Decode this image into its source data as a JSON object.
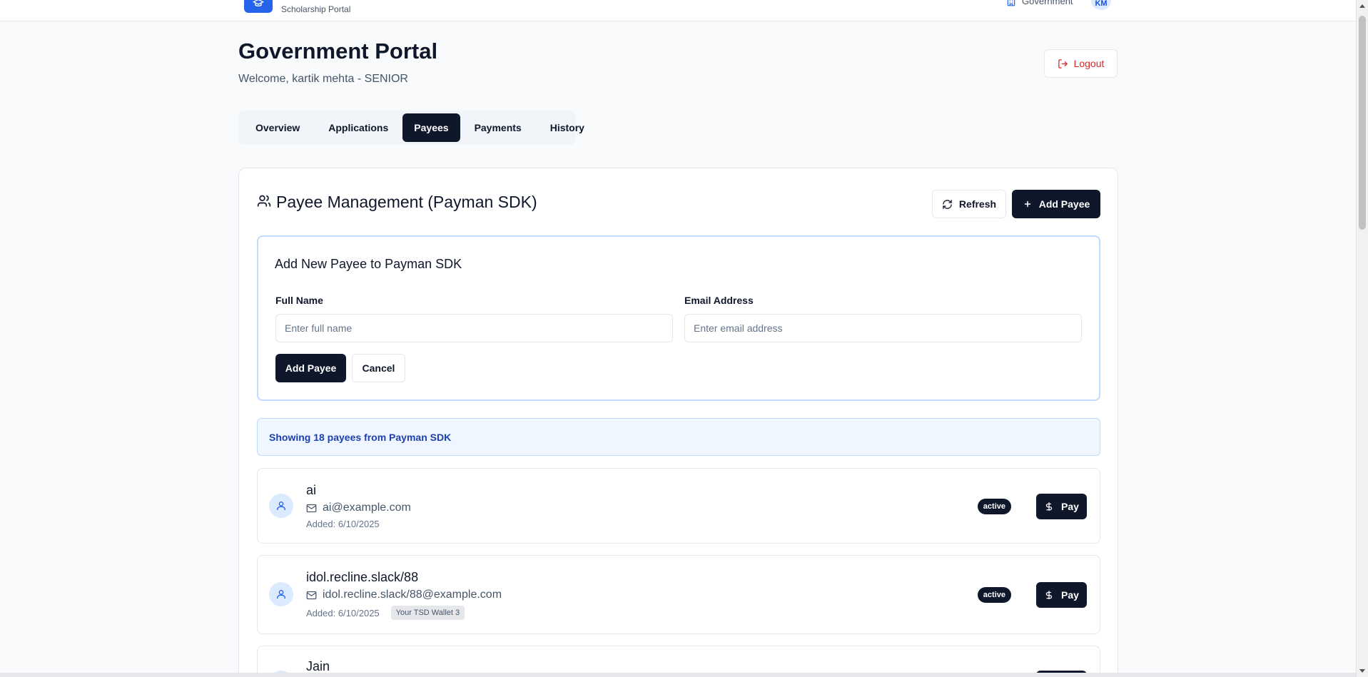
{
  "topbar": {
    "logo_subtitle": "Scholarship Portal",
    "role_label": "Government",
    "avatar_initials": "KM"
  },
  "header": {
    "title": "Government Portal",
    "welcome": "Welcome, kartik mehta - SENIOR",
    "logout_label": "Logout"
  },
  "tabs": [
    {
      "label": "Overview",
      "active": false
    },
    {
      "label": "Applications",
      "active": false
    },
    {
      "label": "Payees",
      "active": true
    },
    {
      "label": "Payments",
      "active": false
    },
    {
      "label": "History",
      "active": false
    }
  ],
  "payee_section": {
    "title": "Payee Management (Payman SDK)",
    "refresh_label": "Refresh",
    "add_label": "Add Payee"
  },
  "add_form": {
    "title": "Add New Payee to Payman SDK",
    "name_label": "Full Name",
    "name_placeholder": "Enter full name",
    "name_value": "",
    "email_label": "Email Address",
    "email_placeholder": "Enter email address",
    "email_value": "",
    "submit_label": "Add Payee",
    "cancel_label": "Cancel"
  },
  "info_banner": "Showing 18 payees from Payman SDK",
  "payees": [
    {
      "name": "ai",
      "email": "ai@example.com",
      "added": "Added: 6/10/2025",
      "wallet": "",
      "status": "active",
      "pay_label": "Pay"
    },
    {
      "name": "idol.recline.slack/88",
      "email": "idol.recline.slack/88@example.com",
      "added": "Added: 6/10/2025",
      "wallet": "Your TSD Wallet 3",
      "status": "active",
      "pay_label": "Pay"
    },
    {
      "name": "Jain",
      "email": "",
      "added": "",
      "wallet": "",
      "status": "",
      "pay_label": ""
    }
  ],
  "colors": {
    "primary": "#0f172a",
    "brand": "#2563eb",
    "danger": "#dc2626",
    "info_bg": "#eff6ff",
    "info_text": "#1e40af"
  }
}
